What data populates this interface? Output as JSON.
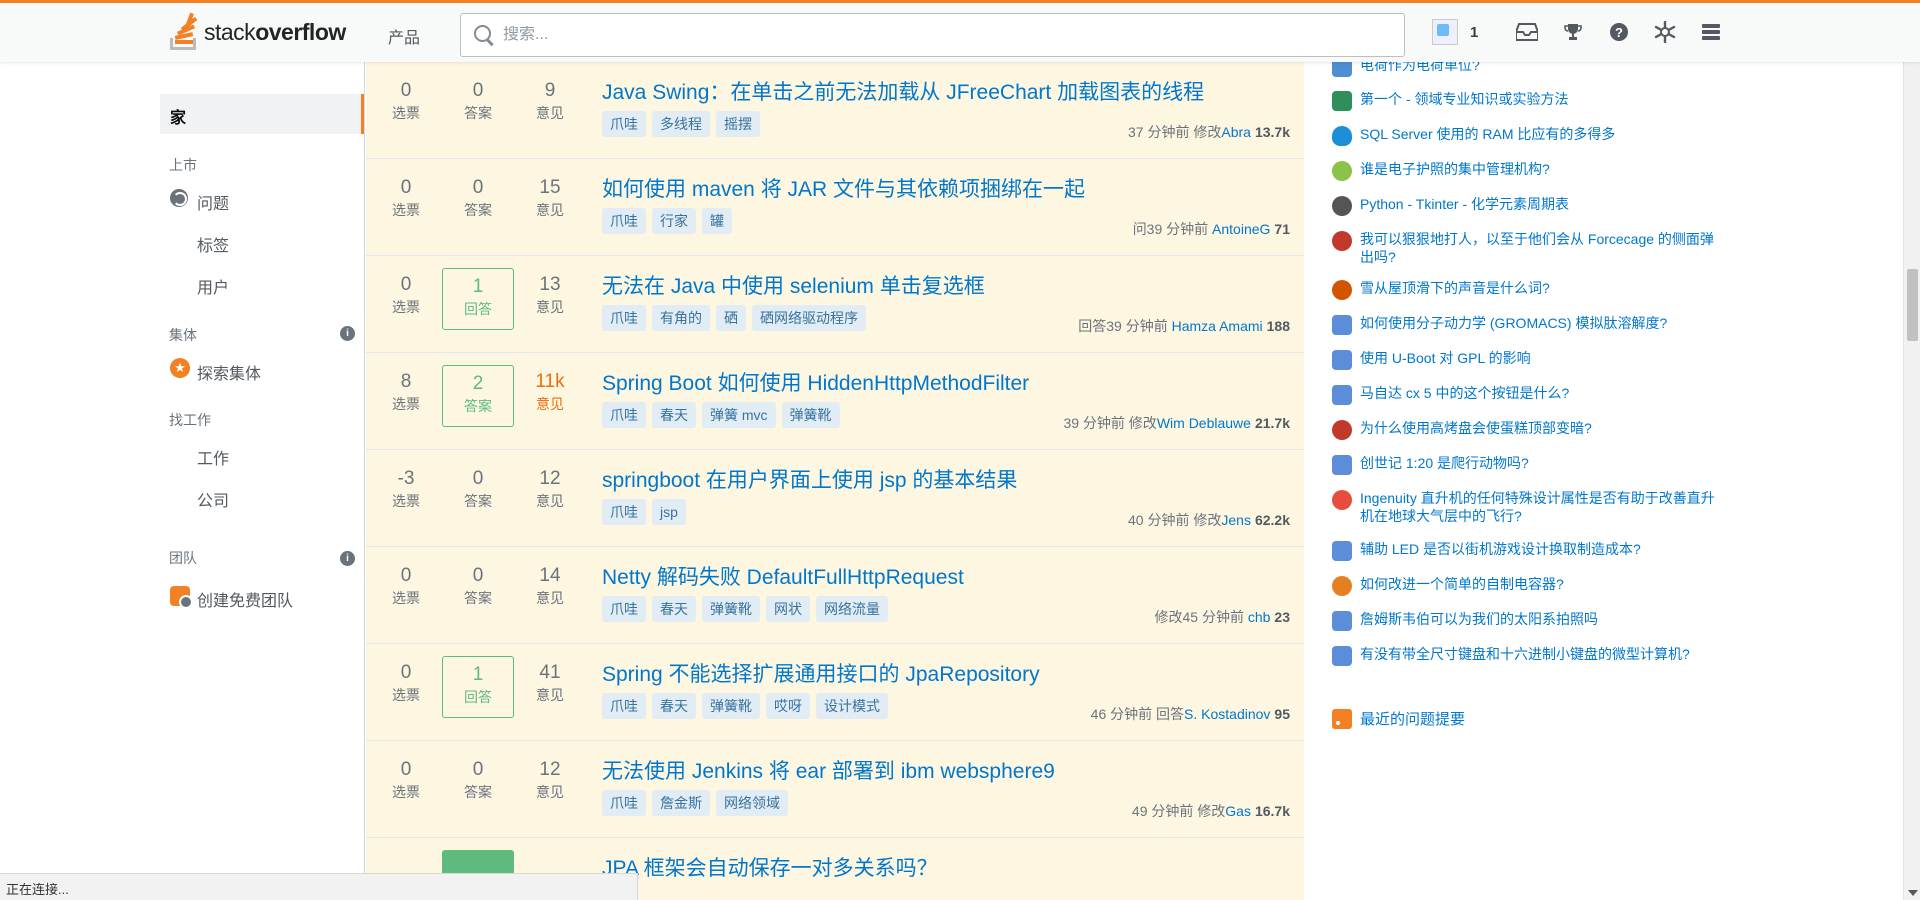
{
  "header": {
    "logo_light": "stack",
    "logo_bold": "overflow",
    "products": "产品",
    "search_placeholder": "搜索...",
    "reputation": "1"
  },
  "sidebar": {
    "home": "家",
    "public_label": "上市",
    "questions": "问题",
    "tags": "标签",
    "users": "用户",
    "collectives_label": "集体",
    "explore_collectives": "探索集体",
    "jobs_label": "找工作",
    "jobs": "工作",
    "companies": "公司",
    "teams_label": "团队",
    "create_team": "创建免费团队"
  },
  "questions": [
    {
      "votes": "0",
      "votes_label": "选票",
      "answers": "0",
      "answers_label": "答案",
      "views": "9",
      "views_label": "意见",
      "title": "Java Swing：在单击之前无法加载从 JFreeChart 加载图表的线程",
      "tags": [
        "爪哇",
        "多线程",
        "摇摆"
      ],
      "meta_time": "37 分钟前 修改",
      "user": "Abra",
      "rep": "13.7k",
      "answered": false,
      "hot": false
    },
    {
      "votes": "0",
      "votes_label": "选票",
      "answers": "0",
      "answers_label": "答案",
      "views": "15",
      "views_label": "意见",
      "title": "如何使用 maven 将 JAR 文件与其依赖项捆绑在一起",
      "tags": [
        "爪哇",
        "行家",
        "罐"
      ],
      "meta_time": "问39 分钟前",
      "user": "AntoineG",
      "rep": "71",
      "answered": false,
      "hot": false
    },
    {
      "votes": "0",
      "votes_label": "选票",
      "answers": "1",
      "answers_label": "回答",
      "views": "13",
      "views_label": "意见",
      "title": "无法在 Java 中使用 selenium 单击复选框",
      "tags": [
        "爪哇",
        "有角的",
        "硒",
        "硒网络驱动程序"
      ],
      "meta_time": "回答39 分钟前",
      "user": "Hamza Amami",
      "rep": "188",
      "answered": true,
      "hot": false
    },
    {
      "votes": "8",
      "votes_label": "选票",
      "answers": "2",
      "answers_label": "答案",
      "views": "11k",
      "views_label": "意见",
      "title": "Spring Boot 如何使用 HiddenHttpMethodFilter",
      "tags": [
        "爪哇",
        "春天",
        "弹簧 mvc",
        "弹簧靴"
      ],
      "meta_time": "39 分钟前 修改",
      "user": "Wim Deblauwe",
      "rep": "21.7k",
      "answered": true,
      "hot": true
    },
    {
      "votes": "-3",
      "votes_label": "选票",
      "answers": "0",
      "answers_label": "答案",
      "views": "12",
      "views_label": "意见",
      "title": "springboot 在用户界面上使用 jsp 的基本结果",
      "tags": [
        "爪哇",
        "jsp"
      ],
      "meta_time": "40 分钟前 修改",
      "user": "Jens",
      "rep": "62.2k",
      "answered": false,
      "hot": false
    },
    {
      "votes": "0",
      "votes_label": "选票",
      "answers": "0",
      "answers_label": "答案",
      "views": "14",
      "views_label": "意见",
      "title": "Netty 解码失败 DefaultFullHttpRequest",
      "tags": [
        "爪哇",
        "春天",
        "弹簧靴",
        "网状",
        "网络流量"
      ],
      "meta_time": "修改45 分钟前",
      "user": "chb",
      "rep": "23",
      "answered": false,
      "hot": false
    },
    {
      "votes": "0",
      "votes_label": "选票",
      "answers": "1",
      "answers_label": "回答",
      "views": "41",
      "views_label": "意见",
      "title": "Spring 不能选择扩展通用接口的 JpaRepository",
      "tags": [
        "爪哇",
        "春天",
        "弹簧靴",
        "哎呀",
        "设计模式"
      ],
      "meta_time": "46 分钟前 回答",
      "user": "S. Kostadinov",
      "rep": "95",
      "answered": true,
      "hot": false
    },
    {
      "votes": "0",
      "votes_label": "选票",
      "answers": "0",
      "answers_label": "答案",
      "views": "12",
      "views_label": "意见",
      "title": "无法使用 Jenkins 将 ear 部署到 ibm websphere9",
      "tags": [
        "爪哇",
        "詹金斯",
        "网络领域"
      ],
      "meta_time": "49 分钟前 修改",
      "user": "Gas",
      "rep": "16.7k",
      "answered": false,
      "hot": false
    },
    {
      "title": "JPA 框架会自动保存一对多关系吗？"
    }
  ],
  "hot_network": [
    {
      "text": "电荷作为电荷单位?",
      "color": "#4e8fd4"
    },
    {
      "text": "第一个 - 领域专业知识或实验方法",
      "color": "#2f8f5b"
    },
    {
      "text": "SQL Server 使用的 RAM 比应有的多得多",
      "color": "#1c8fd6"
    },
    {
      "text": "谁是电子护照的集中管理机构?",
      "color": "#8bc34a"
    },
    {
      "text": "Python - Tkinter - 化学元素周期表",
      "color": "#555555"
    },
    {
      "text": "我可以狠狠地打人，以至于他们会从 Forcecage 的侧面弹出吗?",
      "color": "#c0392b"
    },
    {
      "text": "雪从屋顶滑下的声音是什么词?",
      "color": "#d35400"
    },
    {
      "text": "如何使用分子动力学 (GROMACS) 模拟肽溶解度?",
      "color": "#5b8dd9"
    },
    {
      "text": "使用 U-Boot 对 GPL 的影响",
      "color": "#5b8dd9"
    },
    {
      "text": "马自达 cx 5 中的这个按钮是什么?",
      "color": "#5b8dd9"
    },
    {
      "text": "为什么使用高烤盘会使蛋糕顶部变暗?",
      "color": "#c0392b"
    },
    {
      "text": "创世记 1:20 是爬行动物吗?",
      "color": "#5b8dd9"
    },
    {
      "text": "Ingenuity 直升机的任何特殊设计属性是否有助于改善直升机在地球大气层中的飞行?",
      "color": "#e74c3c"
    },
    {
      "text": "辅助 LED 是否以街机游戏设计换取制造成本?",
      "color": "#5b8dd9"
    },
    {
      "text": "如何改进一个简单的自制电容器?",
      "color": "#e67e22"
    },
    {
      "text": "詹姆斯韦伯可以为我们的太阳系拍照吗",
      "color": "#5b8dd9"
    },
    {
      "text": "有没有带全尺寸键盘和十六进制小键盘的微型计算机?",
      "color": "#5b8dd9"
    }
  ],
  "rss": "最近的问题提要",
  "status": "正在连接..."
}
